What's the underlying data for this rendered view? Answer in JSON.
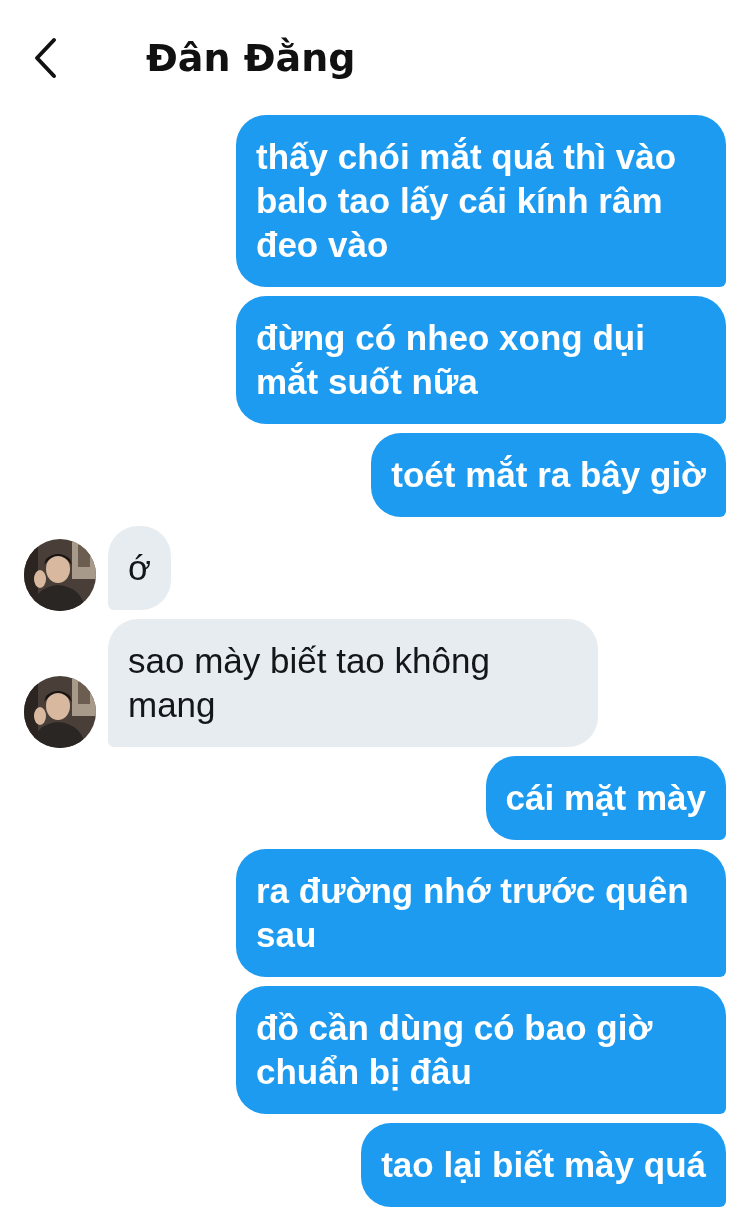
{
  "header": {
    "title": "Đân Đằng"
  },
  "messages": [
    {
      "kind": "sent",
      "text": "thấy chói mắt quá thì vào balo tao lấy cái kính râm đeo vào"
    },
    {
      "kind": "sent",
      "text": "đừng có nheo xong dụi mắt suốt nữa"
    },
    {
      "kind": "sent",
      "text": "toét mắt ra bây giờ"
    },
    {
      "kind": "received",
      "text": "ớ"
    },
    {
      "kind": "received",
      "text": "sao mày biết tao không mang"
    },
    {
      "kind": "sent",
      "text": "cái mặt mày"
    },
    {
      "kind": "sent",
      "text": "ra đường nhớ trước quên sau"
    },
    {
      "kind": "sent",
      "text": "đồ cần dùng có bao giờ chuẩn bị đâu"
    },
    {
      "kind": "sent",
      "text": "tao lại biết mày quá"
    }
  ]
}
